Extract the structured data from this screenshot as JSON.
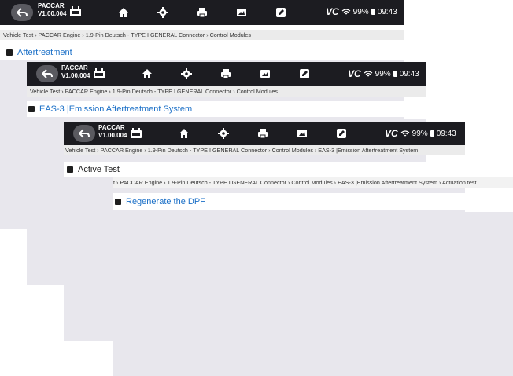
{
  "app": {
    "brand": "PACCAR",
    "version": "V1.00.004",
    "vci_label": "VCI",
    "status": {
      "vc": "VC",
      "battery": "99%",
      "time": "09:43"
    }
  },
  "icons": [
    "back-icon",
    "vci-icon",
    "home-icon",
    "gear-icon",
    "print-icon",
    "screenshot-icon",
    "edit-icon",
    "wifi-icon",
    "battery-icon"
  ],
  "screens": [
    {
      "breadcrumb": "Vehicle Test › PACCAR Engine › 1.9-Pin Deutsch - TYPE I GENERAL Connector › Control Modules",
      "item": "Aftertreatment"
    },
    {
      "breadcrumb": "Vehicle Test › PACCAR Engine › 1.9-Pin Deutsch - TYPE I GENERAL Connector › Control Modules",
      "item": "EAS-3 |Emission Aftertreatment System"
    },
    {
      "breadcrumb": "Vehicle Test › PACCAR Engine › 1.9-Pin Deutsch - TYPE I GENERAL Connector › Control Modules › EAS-3 |Emission Aftertreatment System",
      "item": "Active Test"
    },
    {
      "breadcrumb": "t › PACCAR Engine › 1.9-Pin Deutsch - TYPE I GENERAL Connector › Control Modules › EAS-3 |Emission Aftertreatment System › Actuation test",
      "item": "Regenerate the DPF"
    }
  ],
  "colors": {
    "topbar": "#1c1c21",
    "breadcrumb_bg": "#ebebeb",
    "body_bg": "#e8e7ed",
    "link_blue": "#1a6fc7"
  }
}
